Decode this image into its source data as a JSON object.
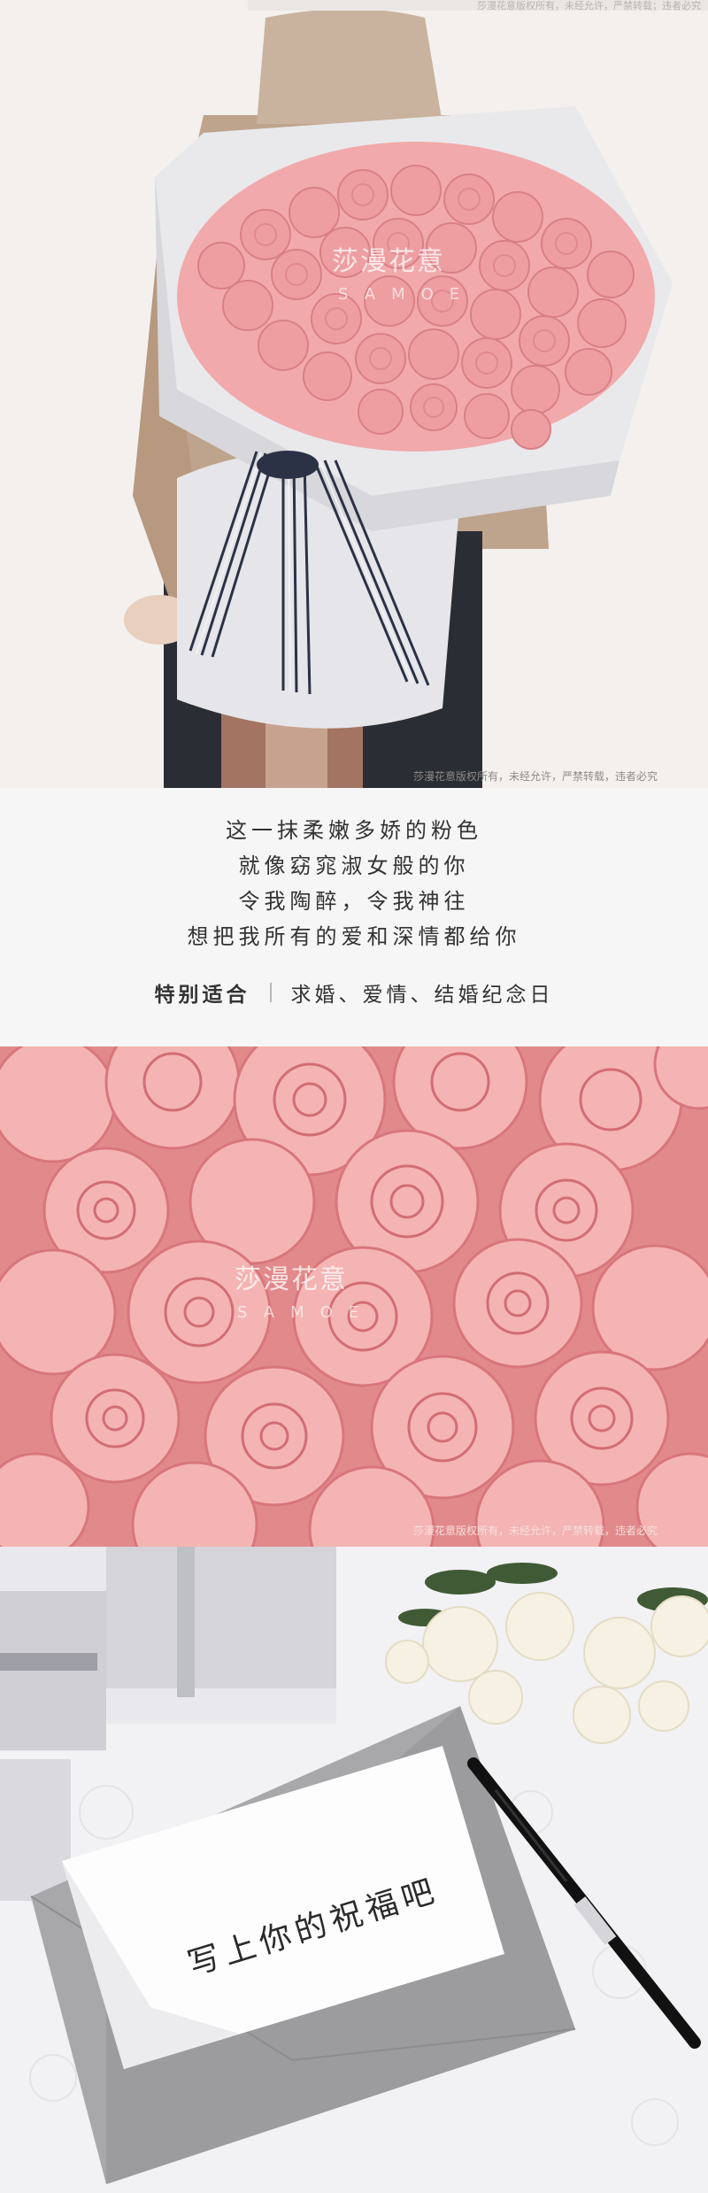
{
  "banner": {
    "top_note": "莎漫花意版权所有，未经允许，严禁转载；违者必究"
  },
  "hero": {
    "watermark_brand": "莎漫花意",
    "watermark_sub": "SAMOE",
    "copyright": "莎漫花意版权所有，未经允许，严禁转载，违者必究"
  },
  "poem": {
    "lines": [
      "这一抹柔嫩多娇的粉色",
      "就像窈窕淑女般的你",
      "令我陶醉，令我神往",
      "想把我所有的爱和深情都给你"
    ]
  },
  "occasion": {
    "label": "特别适合",
    "value": "求婚、爱情、结婚纪念日"
  },
  "closeup": {
    "watermark_brand": "莎漫花意",
    "watermark_sub": "SAMOE",
    "copyright": "莎漫花意版权所有，未经允许，严禁转载，违者必究"
  },
  "card": {
    "text": "写上你的祝福吧"
  },
  "colors": {
    "rose": "#f0a2a4",
    "rose_dark": "#d9777e",
    "paper": "#e6e6e8",
    "envelope": "#a7a7aa"
  }
}
